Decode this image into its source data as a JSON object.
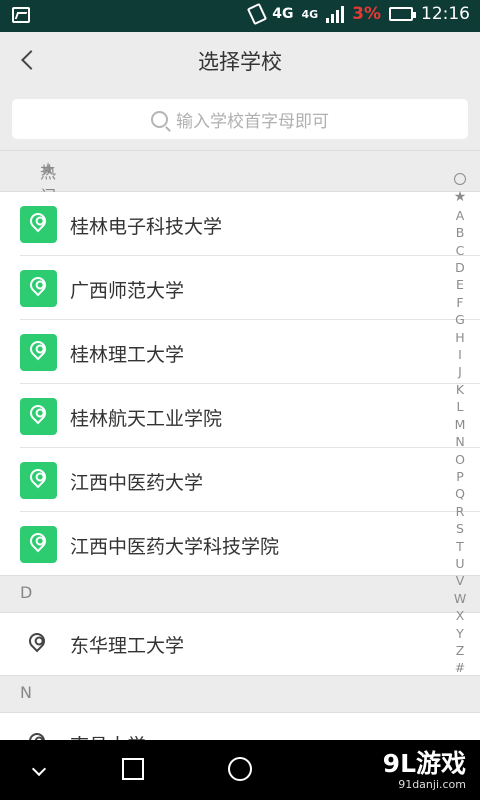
{
  "status_bar": {
    "network": "4G",
    "network2": "4G",
    "battery_percent": "3%",
    "time": "12:16"
  },
  "header": {
    "title": "选择学校"
  },
  "search": {
    "placeholder": "输入学校首字母即可"
  },
  "hot_section": {
    "label": "热门学校"
  },
  "hot_schools": [
    "桂林电子科技大学",
    "广西师范大学",
    "桂林理工大学",
    "桂林航天工业学院",
    "江西中医药大学",
    "江西中医药大学科技学院"
  ],
  "groups": [
    {
      "letter": "D",
      "schools": [
        "东华理工大学"
      ]
    },
    {
      "letter": "N",
      "schools": [
        "南昌大学"
      ]
    }
  ],
  "index_letters": [
    "A",
    "B",
    "C",
    "D",
    "E",
    "F",
    "G",
    "H",
    "I",
    "J",
    "K",
    "L",
    "M",
    "N",
    "O",
    "P",
    "Q",
    "R",
    "S",
    "T",
    "U",
    "V",
    "W",
    "X",
    "Y",
    "Z",
    "#"
  ],
  "watermark": {
    "brand": "9L游戏",
    "domain": "91danji.com"
  },
  "colors": {
    "accent": "#2ecc71",
    "status_bar": "#0e3b36",
    "battery_low": "#e53935"
  }
}
